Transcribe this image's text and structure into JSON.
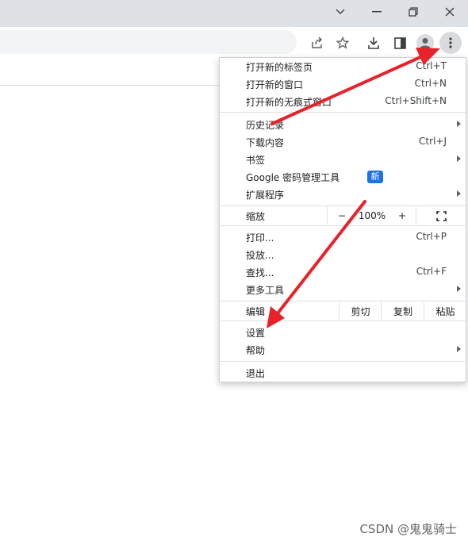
{
  "toolbar_icons": [
    "share-icon",
    "star-icon",
    "download-icon",
    "side-panel-icon",
    "profile-icon",
    "more-vert-icon"
  ],
  "window_controls": [
    "chevron-down-icon",
    "restore-icon",
    "close-icon"
  ],
  "menu": {
    "new_tab": {
      "label": "打开新的标签页",
      "shortcut": "Ctrl+T"
    },
    "new_window": {
      "label": "打开新的窗口",
      "shortcut": "Ctrl+N"
    },
    "incognito": {
      "label": "打开新的无痕式窗口",
      "shortcut": "Ctrl+Shift+N"
    },
    "history": {
      "label": "历史记录"
    },
    "downloads": {
      "label": "下载内容",
      "shortcut": "Ctrl+J"
    },
    "bookmarks": {
      "label": "书签"
    },
    "password_manager": {
      "label": "Google 密码管理工具",
      "badge": "新"
    },
    "extensions": {
      "label": "扩展程序"
    },
    "zoom": {
      "label": "缩放",
      "minus": "−",
      "value": "100%",
      "plus": "+"
    },
    "print": {
      "label": "打印...",
      "shortcut": "Ctrl+P"
    },
    "cast": {
      "label": "投放..."
    },
    "find": {
      "label": "查找...",
      "shortcut": "Ctrl+F"
    },
    "more_tools": {
      "label": "更多工具"
    },
    "edit": {
      "label": "编辑",
      "cut": "剪切",
      "copy": "复制",
      "paste": "粘贴"
    },
    "settings": {
      "label": "设置"
    },
    "help": {
      "label": "帮助"
    },
    "exit": {
      "label": "退出"
    }
  },
  "watermark": "CSDN @鬼鬼骑士",
  "colors": {
    "arrow": "#e8222a",
    "badge": "#1a73e8",
    "titlebar": "#dee1e6"
  }
}
